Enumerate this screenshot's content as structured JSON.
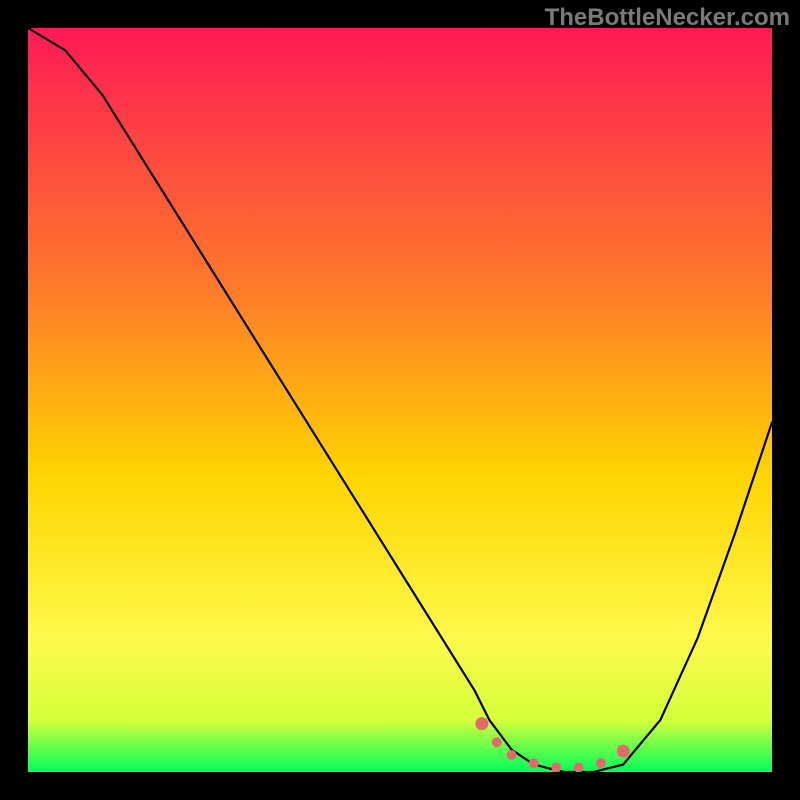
{
  "watermark": "TheBottleNecker.com",
  "colors": {
    "background": "#000000",
    "curve": "#000000",
    "marker": "#e46a6a",
    "gradient_stops": [
      {
        "offset": 0.0,
        "color": "#ff1a55"
      },
      {
        "offset": 0.35,
        "color": "#ff7a2a"
      },
      {
        "offset": 0.6,
        "color": "#ffd400"
      },
      {
        "offset": 0.82,
        "color": "#fff94a"
      },
      {
        "offset": 0.93,
        "color": "#d5ff3a"
      },
      {
        "offset": 1.0,
        "color": "#00ff5a"
      }
    ]
  },
  "chart_data": {
    "type": "line",
    "title": "",
    "xlabel": "",
    "ylabel": "",
    "xlim": [
      0,
      100
    ],
    "ylim": [
      0,
      100
    ],
    "series": [
      {
        "name": "bottleneck-curve",
        "x": [
          0,
          5,
          10,
          15,
          20,
          25,
          30,
          35,
          40,
          45,
          50,
          55,
          60,
          62,
          65,
          68,
          72,
          76,
          80,
          85,
          90,
          95,
          100
        ],
        "y": [
          100,
          97,
          91,
          83,
          75,
          67,
          59,
          51,
          43,
          35,
          27,
          19,
          11,
          7,
          3,
          1,
          0,
          0,
          1,
          7,
          18,
          32,
          47
        ]
      }
    ],
    "markers": {
      "name": "optimal-range",
      "x": [
        61,
        63,
        65,
        68,
        71,
        74,
        77,
        80
      ],
      "y": [
        6.5,
        4,
        2.3,
        1.2,
        0.6,
        0.6,
        1.2,
        2.8
      ]
    }
  }
}
